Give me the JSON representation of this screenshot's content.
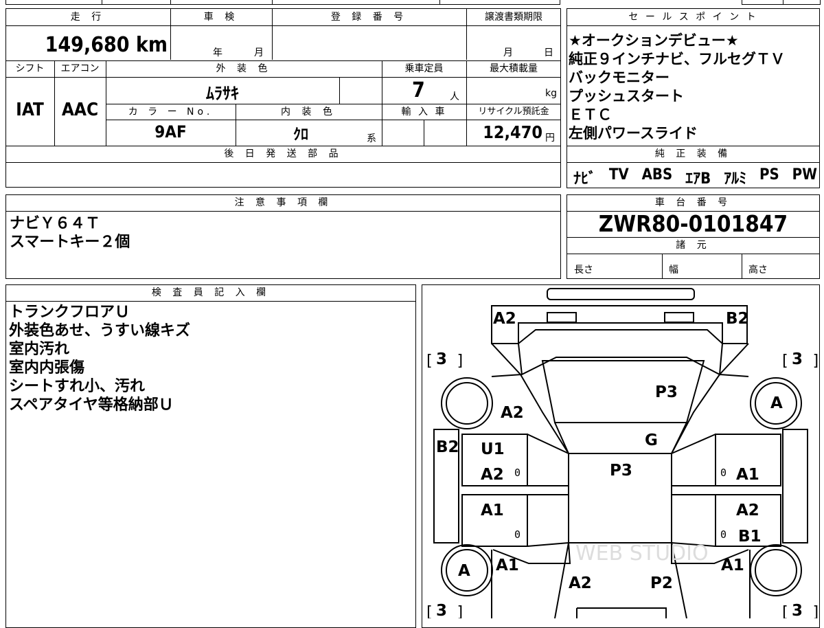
{
  "mileage": {
    "label": "走 行",
    "value": "149,680 km"
  },
  "inspection": {
    "label": "車 検",
    "year_unit": "年",
    "month_unit": "月"
  },
  "registration": {
    "label": "登 録 番 号",
    "value": ""
  },
  "transfer_deadline": {
    "label": "譲渡書類期限",
    "month_unit": "月",
    "day_unit": "日"
  },
  "shift": {
    "label": "シフト",
    "value": "IAT"
  },
  "aircon": {
    "label": "エアコン",
    "value": "AAC"
  },
  "exterior_color": {
    "label": "外 装 色",
    "value": "ﾑﾗｻｷ"
  },
  "capacity": {
    "label": "乗車定員",
    "value": "7",
    "unit": "人"
  },
  "max_load": {
    "label": "最大積載量",
    "unit": "kg"
  },
  "color_no": {
    "label": "カ ラ ー No.",
    "value": "9AF"
  },
  "interior_color": {
    "label": "内 装 色",
    "value": "ｸﾛ",
    "suffix": "系"
  },
  "import_car": {
    "label": "輸 入 車"
  },
  "recycle_fee": {
    "label": "リサイクル預託金",
    "value": "12,470",
    "unit": "円"
  },
  "later_parts": {
    "label": "後 日 発 送 部 品"
  },
  "sales_points": {
    "label": "セ ー ル ス ポ イ ン ト",
    "lines": [
      "★オークションデビュー★",
      "純正９インチナビ、フルセグＴＶ",
      "バックモニター",
      "プッシュスタート",
      "ＥＴＣ",
      "左側パワースライド"
    ]
  },
  "equipment": {
    "label": "純 正 装 備",
    "items": [
      "ﾅﾋﾞ",
      "TV",
      "ABS",
      "ｴｱB",
      "ｱﾙﾐ",
      "PS",
      "PW"
    ]
  },
  "notes": {
    "label": "注 意 事 項 欄",
    "lines": [
      "ナビＹ６４Ｔ",
      "スマートキー２個"
    ]
  },
  "chassis": {
    "label": "車 台 番 号",
    "value": "ZWR80-0101847"
  },
  "specs": {
    "label": "諸 元",
    "length": "長さ",
    "width": "幅",
    "height": "高さ"
  },
  "inspector": {
    "label": "検 査 員 記 入 欄",
    "lines": [
      "トランクフロアＵ",
      "外装色あせ、うすい線キズ",
      "室内汚れ",
      "室内内張傷",
      "シートすれ小、汚れ",
      "スペアタイヤ等格納部Ｕ"
    ]
  },
  "diagram": {
    "marks": {
      "front_left": "A2",
      "front_right": "B2",
      "tire_fl": "[ 3 ]",
      "tire_fr": "[ 3 ]",
      "tire_rl": "[ 3 ]",
      "tire_rr": "[ 3 ]",
      "hood": "P3",
      "left_fender": "A2",
      "wheel_fr": "A",
      "windshield": "G",
      "left_mirror": "B2",
      "roof": "P3",
      "left_door_front_1": "U1",
      "left_door_front_2": "A2",
      "left_door_rear": "A1",
      "right_door_front": "A1",
      "right_door_rear_1": "A2",
      "right_door_rear_2": "B1",
      "wheel_rl": "A",
      "left_quarter": "A1",
      "right_quarter": "A1",
      "rear_left": "A2",
      "rear_right": "P2",
      "zero": "0"
    },
    "watermark": "WEB STUDIO"
  }
}
